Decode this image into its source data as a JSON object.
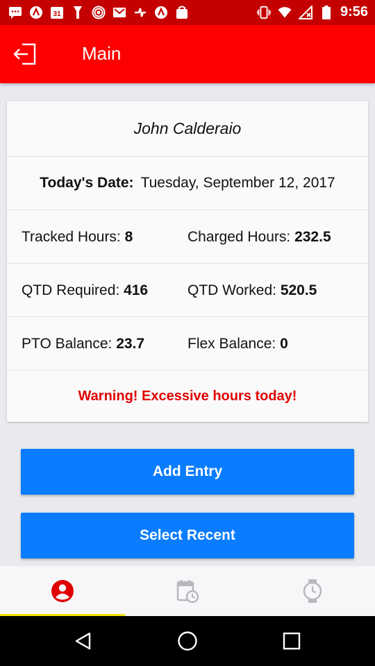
{
  "status_bar": {
    "time": "9:56",
    "calendar_day": "31",
    "left_icons": [
      "messages-icon",
      "app-icon",
      "calendar-icon",
      "tools-icon",
      "wifi-hotspot-icon",
      "mail-icon",
      "wrench-icon",
      "app-icon",
      "bag-icon"
    ],
    "right_icons": [
      "vibrate-icon",
      "wifi-icon",
      "no-signal-icon",
      "battery-icon"
    ]
  },
  "app_bar": {
    "title": "Main"
  },
  "summary": {
    "employee_name": "John Calderaio",
    "date_label": "Today's Date:",
    "date_value": "Tuesday, September 12, 2017",
    "tracked_label": "Tracked Hours: ",
    "tracked_value": "8",
    "charged_label": "Charged Hours: ",
    "charged_value": "232.5",
    "qtd_required_label": "QTD Required: ",
    "qtd_required_value": "416",
    "qtd_worked_label": "QTD Worked: ",
    "qtd_worked_value": "520.5",
    "pto_label": "PTO Balance: ",
    "pto_value": "23.7",
    "flex_label": "Flex Balance: ",
    "flex_value": "0",
    "warning": "Warning! Excessive hours today!"
  },
  "actions": {
    "add_entry_label": "Add Entry",
    "select_recent_label": "Select Recent"
  },
  "tabs": [
    {
      "icon": "account-icon",
      "active": true
    },
    {
      "icon": "calendar-clock-icon",
      "active": false
    },
    {
      "icon": "stopwatch-icon",
      "active": false
    }
  ],
  "colors": {
    "app_bar": "#fe0000",
    "status_bar": "#c40000",
    "button": "#0a7cff",
    "warning": "#e00000",
    "active_tab": "#e00000",
    "inactive_tab": "#b8b8bc",
    "tab_indicator": "#f3e100"
  }
}
